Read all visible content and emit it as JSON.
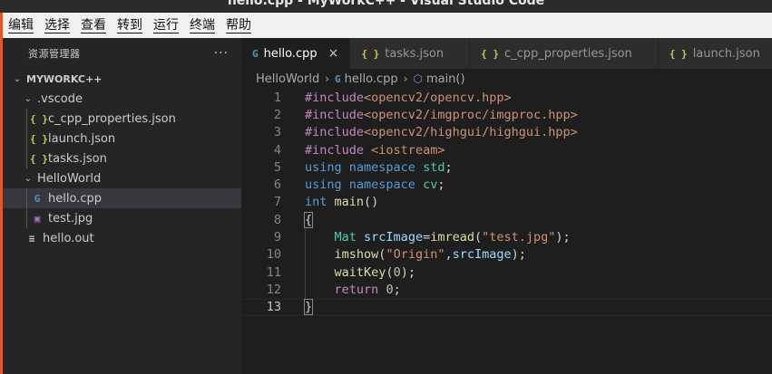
{
  "window": {
    "title": "hello.cpp - MyWorkC++ - Visual Studio Code"
  },
  "menu": [
    "编辑",
    "选择",
    "查看",
    "转到",
    "运行",
    "终端",
    "帮助"
  ],
  "sidebar": {
    "header": "资源管理器",
    "more": "···",
    "root": "MYWORKC++",
    "items": [
      {
        "label": ".vscode",
        "kind": "folder"
      },
      {
        "label": "c_cpp_properties.json",
        "kind": "json"
      },
      {
        "label": "launch.json",
        "kind": "json"
      },
      {
        "label": "tasks.json",
        "kind": "json"
      },
      {
        "label": "HelloWorld",
        "kind": "folder"
      },
      {
        "label": "hello.cpp",
        "kind": "cpp",
        "selected": true
      },
      {
        "label": "test.jpg",
        "kind": "image"
      },
      {
        "label": "hello.out",
        "kind": "text"
      }
    ]
  },
  "tabs": [
    {
      "label": "hello.cpp",
      "icon": "cpp",
      "active": true,
      "close": "×"
    },
    {
      "label": "tasks.json",
      "icon": "json"
    },
    {
      "label": "c_cpp_properties.json",
      "icon": "json"
    },
    {
      "label": "launch.json",
      "icon": "json"
    }
  ],
  "breadcrumb": {
    "folder": "HelloWorld",
    "file": "hello.cpp",
    "symbol": "main()"
  },
  "icons": {
    "json": "{ }",
    "cpp": "G",
    "folder-open": "chevron-down-icon",
    "image": "image-icon",
    "text": "lines-icon"
  },
  "editor": {
    "line_numbers": [
      "1",
      "2",
      "3",
      "4",
      "5",
      "6",
      "7",
      "8",
      "9",
      "10",
      "11",
      "12",
      "13"
    ],
    "current_line": 13,
    "lines": [
      "#include<opencv2/opencv.hpp>",
      "#include<opencv2/imgproc/imgproc.hpp>",
      "#include<opencv2/highgui/highgui.hpp>",
      "#include <iostream>",
      "using namespace std;",
      "using namespace cv;",
      "int main()",
      "{",
      "    Mat srcImage=imread(\"test.jpg\");",
      "    imshow(\"Origin\",srcImage);",
      "    waitKey(0);",
      "    return 0;",
      "}"
    ]
  },
  "colors": {
    "accent": "#e95420",
    "background": "#1e1e1e",
    "sidebar": "#252526"
  }
}
